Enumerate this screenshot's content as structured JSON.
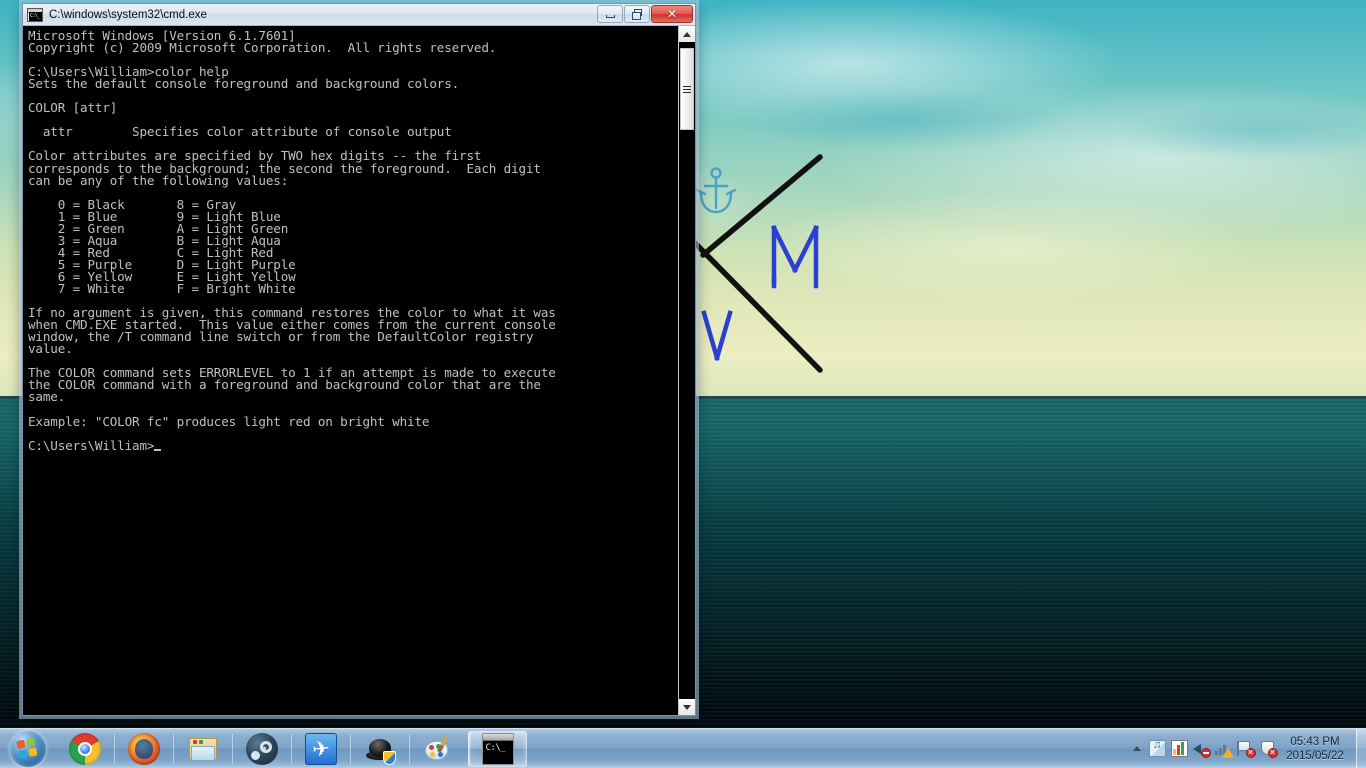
{
  "window": {
    "title": "C:\\windows\\system32\\cmd.exe",
    "icon": "cmd-icon",
    "buttons": {
      "minimize": "minimize-button",
      "restore": "restore-button",
      "close_label": "✕"
    }
  },
  "console": {
    "lines": [
      "Microsoft Windows [Version 6.1.7601]",
      "Copyright (c) 2009 Microsoft Corporation.  All rights reserved.",
      "",
      "C:\\Users\\William>color help",
      "Sets the default console foreground and background colors.",
      "",
      "COLOR [attr]",
      "",
      "  attr        Specifies color attribute of console output",
      "",
      "Color attributes are specified by TWO hex digits -- the first",
      "corresponds to the background; the second the foreground.  Each digit",
      "can be any of the following values:",
      "",
      "    0 = Black       8 = Gray",
      "    1 = Blue        9 = Light Blue",
      "    2 = Green       A = Light Green",
      "    3 = Aqua        B = Light Aqua",
      "    4 = Red         C = Light Red",
      "    5 = Purple      D = Light Purple",
      "    6 = Yellow      E = Light Yellow",
      "    7 = White       F = Bright White",
      "",
      "If no argument is given, this command restores the color to what it was",
      "when CMD.EXE started.  This value either comes from the current console",
      "window, the /T command line switch or from the DefaultColor registry",
      "value.",
      "",
      "The COLOR command sets ERRORLEVEL to 1 if an attempt is made to execute",
      "the COLOR command with a foreground and background color that are the",
      "same.",
      "",
      "Example: \"COLOR fc\" produces light red on bright white",
      ""
    ],
    "prompt": "C:\\Users\\William>",
    "foreground_color": "#c0c0c0",
    "background_color": "#000000"
  },
  "scrollbar": {
    "up_arrow": "scroll-up-arrow",
    "down_arrow": "scroll-down-arrow",
    "thumb": "scroll-thumb"
  },
  "desktop": {
    "doodle": {
      "letter_m": "M",
      "letter_v": "V",
      "anchor": "anchor-icon",
      "ink_color": "#2b3fd0",
      "anchor_color": "#4aa3c4",
      "line_color": "#111111"
    },
    "wallpaper": {
      "sky_top_color": "#3fb4c4",
      "sky_bottom_color": "#e6ebbe",
      "sea_top_color": "#0b5458",
      "sea_bottom_color": "#000709"
    }
  },
  "taskbar": {
    "start_label": "Start",
    "items": [
      {
        "name": "taskbar-item-chrome",
        "icon": "chrome-icon",
        "active": false
      },
      {
        "name": "taskbar-item-firefox",
        "icon": "firefox-icon",
        "active": false
      },
      {
        "name": "taskbar-item-explorer",
        "icon": "windows-explorer-icon",
        "active": false
      },
      {
        "name": "taskbar-item-steam",
        "icon": "steam-icon",
        "active": false
      },
      {
        "name": "taskbar-item-plane",
        "icon": "airplane-icon",
        "active": false
      },
      {
        "name": "taskbar-item-ink",
        "icon": "ink-drop-shield-icon",
        "active": false
      },
      {
        "name": "taskbar-item-paint",
        "icon": "paint-palette-icon",
        "active": false
      },
      {
        "name": "taskbar-item-cmd",
        "icon": "command-prompt-icon",
        "active": true
      }
    ],
    "tray": {
      "expand": "show-hidden-icons-chevron",
      "icons": [
        "media-player-icon",
        "equalizer-bars-icon",
        "speaker-muted-icon",
        "network-warning-icon",
        "action-center-flag-error-icon",
        "security-shield-error-icon"
      ],
      "clock": {
        "time": "05:43 PM",
        "date": "2015/05/22"
      }
    }
  }
}
